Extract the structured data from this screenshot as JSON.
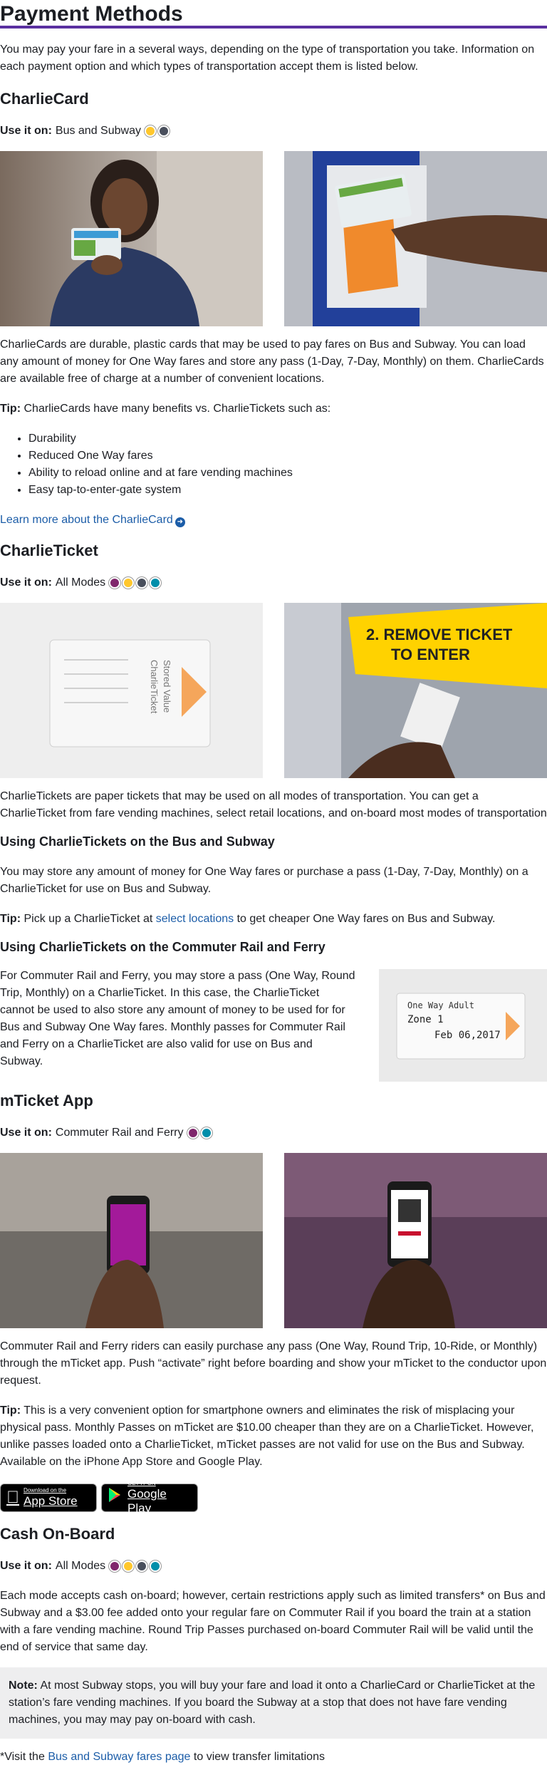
{
  "page_title": "Payment Methods",
  "intro": "You may pay your fare in a several ways, depending on the type of transportation you take. Information on each payment option and which types of transportation accept them is listed below.",
  "use_it_on_label": "Use it on:",
  "charliecard": {
    "heading": "CharlieCard",
    "use_it_on": "Bus and Subway",
    "mode_icons": [
      "bus-icon",
      "subway-icon"
    ],
    "body": "CharlieCards are durable, plastic cards that may be used to pay fares on Bus and Subway. You can load any amount of money for One Way fares and store any pass (1-Day, 7-Day, Monthly) on them. CharlieCards are available free of charge at a number of convenient locations.",
    "tip_label": "Tip:",
    "tip_text": "CharlieCards have many benefits vs. CharlieTickets such as:",
    "benefits": [
      "Durability",
      "Reduced One Way fares",
      "Ability to reload online and at fare vending machines",
      "Easy tap-to-enter-gate system"
    ],
    "learn_more": "Learn more about the CharlieCard"
  },
  "charlieticket": {
    "heading": "CharlieTicket",
    "use_it_on": "All Modes",
    "mode_icons": [
      "commuter-rail-icon",
      "bus-icon",
      "subway-icon",
      "ferry-icon"
    ],
    "body": "CharlieTickets are paper tickets that may be used on all modes of transportation. You can get a CharlieTicket from fare vending machines, select retail locations, and on-board most modes of transportation",
    "bus_subway_heading": "Using CharlieTickets on the Bus and Subway",
    "bus_subway_body": "You may store any amount of money for One Way fares or purchase a pass (1-Day, 7-Day, Monthly) on a CharlieTicket for use on Bus and Subway.",
    "tip_label": "Tip:",
    "tip_pre": "Pick up a CharlieTicket at",
    "tip_link": "select locations",
    "tip_post": "to get cheaper One Way fares on Bus and Subway.",
    "cr_ferry_heading": "Using CharlieTickets on the Commuter Rail and Ferry",
    "cr_ferry_body": "For Commuter Rail and Ferry, you may store a pass (One Way, Round Trip, Monthly) on a CharlieTicket. In this case, the CharlieTicket cannot be used to also store any amount of money to be used for for Bus and Subway One Way fares. Monthly passes for Commuter Rail and Ferry on a CharlieTicket are also valid for use on Bus and Subway.",
    "ticket_photo_text": [
      "One Way Adult",
      "Zone 1",
      "Feb 06,2017"
    ],
    "stored_value_text": [
      "Stored Value",
      "CharlieTicket"
    ],
    "remove_ticket_text": [
      "2. REMOVE TICKET",
      "TO ENTER"
    ]
  },
  "mticket": {
    "heading": "mTicket App",
    "use_it_on": "Commuter Rail and Ferry",
    "mode_icons": [
      "commuter-rail-icon",
      "ferry-icon"
    ],
    "body": "Commuter Rail and Ferry riders can easily purchase any pass (One Way, Round Trip, 10-Ride, or Monthly) through the mTicket app. Push “activate” right before boarding and show your mTicket to the conductor upon request.",
    "tip_label": "Tip:",
    "tip_text": "This is a very convenient option for smartphone owners and eliminates the risk of misplacing your physical pass. Monthly Passes on mTicket are $10.00 cheaper than they are on a CharlieTicket. However, unlike passes loaded onto a CharlieTicket, mTicket passes are not valid for use on the Bus and Subway. Available on the iPhone App Store and Google Play.",
    "app_store_small": "Download on the",
    "app_store_big": "App Store",
    "google_play_small": "GET IT ON",
    "google_play_big": "Google Play"
  },
  "cash": {
    "heading": "Cash On-Board",
    "use_it_on": "All Modes",
    "mode_icons": [
      "commuter-rail-icon",
      "bus-icon",
      "subway-icon",
      "ferry-icon"
    ],
    "body": "Each mode accepts cash on-board; however, certain restrictions apply such as limited transfers* on Bus and Subway and a $3.00 fee added onto your regular fare on Commuter Rail if you board the train at a station with a fare vending machine. Round Trip Passes purchased on-board Commuter Rail will be valid until the end of service that same day.",
    "note_label": "Note:",
    "note_text": "At most Subway stops, you will buy your fare and load it onto a CharlieCard or CharlieTicket at the station’s fare vending machines. If you board the Subway at a stop that does not have fare vending machines, you may may pay on-board with cash.",
    "footnote_pre": "*Visit the",
    "footnote_link": "Bus and Subway fares page",
    "footnote_post": "to view transfer limitations"
  },
  "colors": {
    "accent": "#5a30a0",
    "link": "#1c5da8",
    "commuter_rail": "#80276c",
    "bus": "#ffc72c",
    "subway": "#494f5c",
    "ferry": "#008eaa"
  }
}
